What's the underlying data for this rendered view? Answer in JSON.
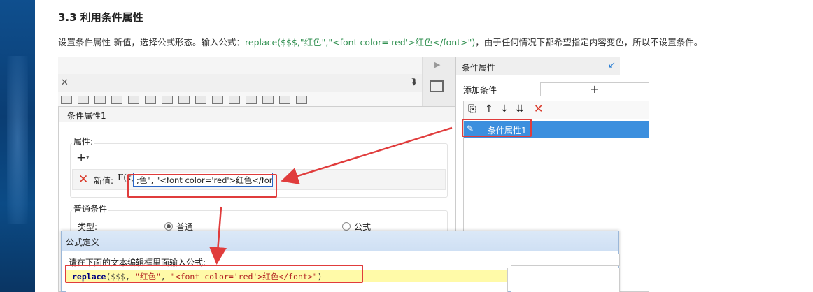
{
  "heading": "3.3 利用条件属性",
  "paragraph": {
    "text_before": "设置条件属性-新值，选择公式形态。输入公式：",
    "code": "replace($$$,\"红色\",\"<font color='red'>红色</font>\")",
    "text_after": "，由于任何情况下都希望指定内容变色，所以不设置条件。"
  },
  "panel": {
    "title": "条件属性",
    "add_label": "添加条件",
    "add_button": "+",
    "tools": [
      "copy-icon",
      "arrow-up-icon",
      "arrow-down-icon",
      "move-bottom-icon",
      "delete-icon"
    ],
    "selected_item": "条件属性1"
  },
  "dialog": {
    "title": "条件属性1",
    "attr_section": "属性:",
    "add_symbol": "+",
    "new_value_label": "新值:",
    "fx_label": "F(x)",
    "formula_input": ";色\", \"<font color='red'>红色</font>\")",
    "normal_condition": "普通条件",
    "type_label": "类型:",
    "radio_normal": "普通",
    "radio_formula": "公式"
  },
  "formula_dialog": {
    "title": "公式定义",
    "prompt": "请在下面的文本编辑框里面输入公式:",
    "code_fn": "replace",
    "code_rest_1": "($$$, ",
    "code_str_1": "\"红色\"",
    "code_comma": ", ",
    "code_str_2": "\"<font color='red'>红色</font>\"",
    "code_close": ")"
  },
  "colors": {
    "highlight": "#e03c3c",
    "selection": "#3c8fde",
    "code_green": "#2f8f4f"
  }
}
